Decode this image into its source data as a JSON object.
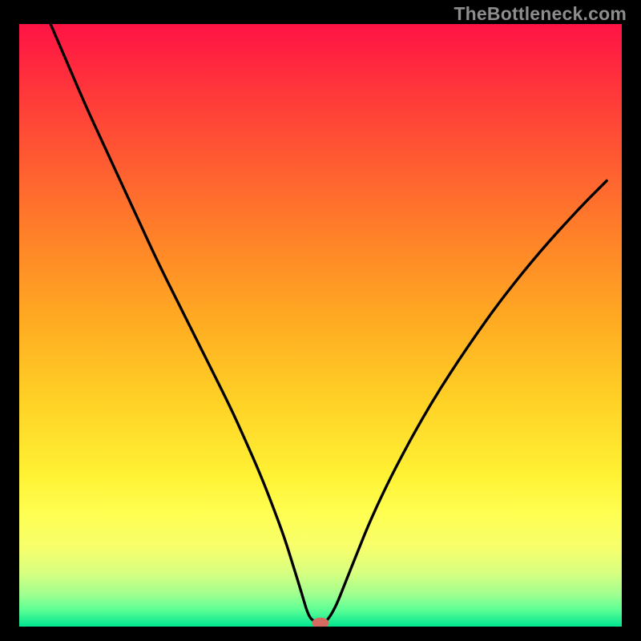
{
  "watermark": "TheBottleneck.com",
  "chart_data": {
    "type": "line",
    "title": "",
    "xlabel": "",
    "ylabel": "",
    "x_range": [
      0,
      100
    ],
    "y_range": [
      0,
      100
    ],
    "background_gradient": {
      "stops": [
        {
          "pos": 0.0,
          "color": "#ff1345"
        },
        {
          "pos": 0.125,
          "color": "#ff3b39"
        },
        {
          "pos": 0.25,
          "color": "#ff6230"
        },
        {
          "pos": 0.375,
          "color": "#ff8827"
        },
        {
          "pos": 0.5,
          "color": "#ffad22"
        },
        {
          "pos": 0.625,
          "color": "#ffd126"
        },
        {
          "pos": 0.75,
          "color": "#fff234"
        },
        {
          "pos": 0.815,
          "color": "#ffff53"
        },
        {
          "pos": 0.87,
          "color": "#f6ff6c"
        },
        {
          "pos": 0.91,
          "color": "#d8ff80"
        },
        {
          "pos": 0.945,
          "color": "#a3ff8f"
        },
        {
          "pos": 0.972,
          "color": "#5dff95"
        },
        {
          "pos": 1.0,
          "color": "#00e590"
        }
      ]
    },
    "series": [
      {
        "name": "bottleneck-curve",
        "color": "#000000",
        "x": [
          5.2,
          8,
          11,
          14,
          17,
          20,
          23,
          26,
          29,
          32,
          35,
          37.5,
          40,
          42,
          44,
          45.5,
          46.8,
          48.0,
          49.0,
          50.0,
          51.0,
          52.5,
          54,
          56,
          58,
          61,
          64,
          67,
          70,
          73,
          76,
          79,
          82,
          85,
          88,
          91,
          94,
          97.5
        ],
        "y": [
          100,
          93.5,
          86.5,
          80,
          73.5,
          67,
          60.5,
          54.5,
          48.5,
          42.5,
          36.5,
          31,
          25.3,
          20.2,
          14.8,
          10.0,
          5.8,
          1.7,
          0.8,
          0.6,
          0.8,
          3.2,
          7.0,
          12.0,
          17.0,
          23.5,
          29.3,
          34.7,
          39.7,
          44.3,
          48.7,
          52.9,
          56.8,
          60.5,
          64.0,
          67.3,
          70.5,
          74.0
        ]
      }
    ],
    "marker": {
      "name": "optimal-point",
      "x": 50.0,
      "y": 0.6,
      "color": "#d46a60",
      "rx": 1.4,
      "ry": 0.9
    }
  }
}
